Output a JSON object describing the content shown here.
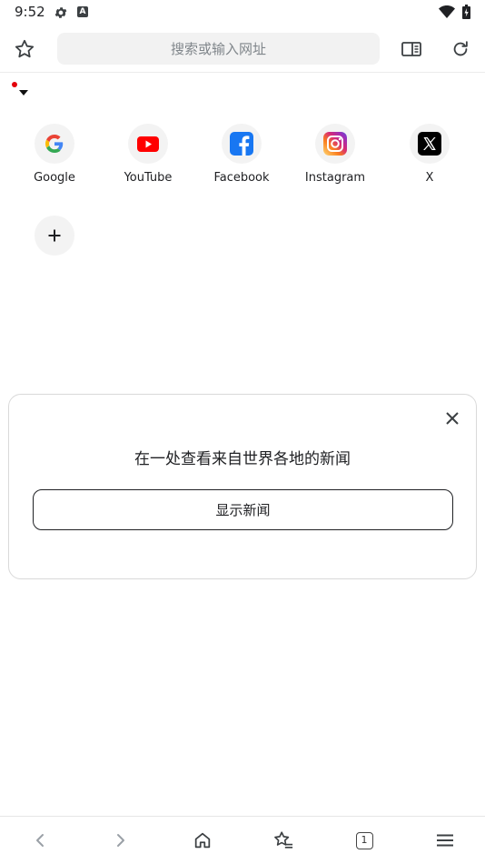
{
  "status_bar": {
    "time": "9:52",
    "notification_icons": [
      "settings-icon",
      "a-icon"
    ],
    "system_icons": [
      "wifi-icon",
      "battery-icon"
    ]
  },
  "toolbar": {
    "url_placeholder": "搜索或输入网址",
    "icons": [
      "star-icon",
      "reader-view-icon",
      "reload-icon"
    ]
  },
  "shortcuts": [
    {
      "label": "Google",
      "icon": "google-icon"
    },
    {
      "label": "YouTube",
      "icon": "youtube-icon"
    },
    {
      "label": "Facebook",
      "icon": "facebook-icon"
    },
    {
      "label": "Instagram",
      "icon": "instagram-icon"
    },
    {
      "label": "X",
      "icon": "x-icon"
    }
  ],
  "add_shortcut_icon": "plus-icon",
  "news_card": {
    "title": "在一处查看来自世界各地的新闻",
    "button_label": "显示新闻",
    "close_icon": "close-icon"
  },
  "bottom_nav": {
    "tab_count": "1",
    "icons": [
      "back-icon",
      "forward-icon",
      "home-icon",
      "bookmarks-icon",
      "tabs-icon",
      "menu-icon"
    ]
  },
  "colors": {
    "accent_red": "#e3000b",
    "youtube_red": "#ff0000",
    "facebook_blue": "#1877f2",
    "url_bar_bg": "#f2f2f2"
  }
}
